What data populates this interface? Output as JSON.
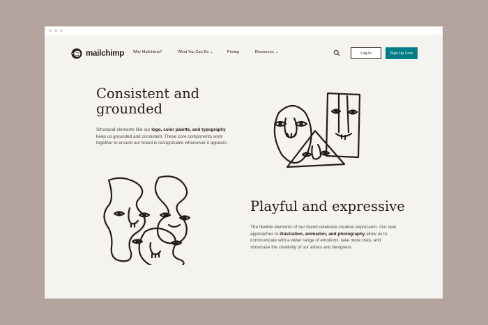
{
  "nav": {
    "brand": "mailchimp",
    "links": [
      {
        "label": "Why Mailchimp?",
        "chevron": false
      },
      {
        "label": "What You Can Do",
        "chevron": true
      },
      {
        "label": "Pricing",
        "chevron": false
      },
      {
        "label": "Resources",
        "chevron": true
      }
    ],
    "login_label": "Log In",
    "signup_label": "Sign Up Free",
    "search_icon": "search-icon"
  },
  "section_consistent": {
    "heading": "Consistent and grounded",
    "text_1": "Structural elements like our ",
    "bold_1": "logo, color palette, and typography",
    "text_2": " keep us grounded and consistent. These core components work together to ensure our brand is recognizable whereever it appears."
  },
  "section_playful": {
    "heading": "Playful and expressive",
    "text_1": "The flexible elements of our brand celebrate creative expression. Our new approaches to ",
    "bold_1": "illustration, animation, and photography",
    "text_2": " allow us to communicate with a wider range of emotions, take more risks, and showcase the creativity of our artists and designers."
  },
  "colors": {
    "backdrop": "#b3a59d",
    "page": "#f4f3ef",
    "ink": "#241c15",
    "signup_button": "#007c89"
  }
}
